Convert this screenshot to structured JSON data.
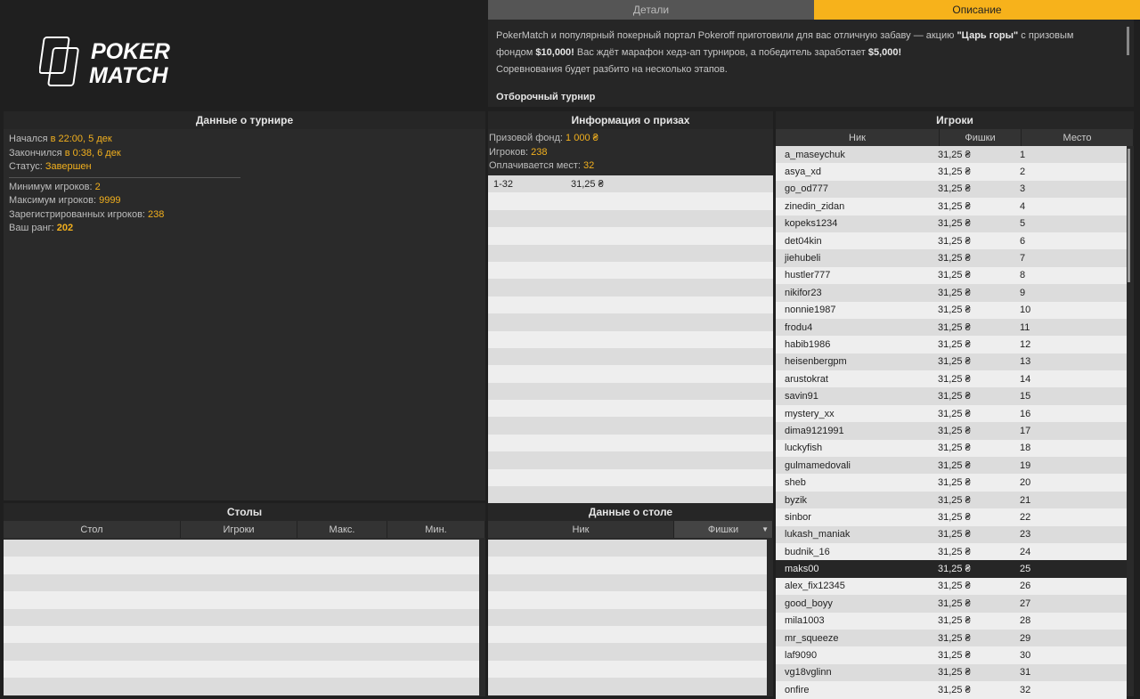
{
  "logo": {
    "line1": "POKER",
    "line2": "MATCH"
  },
  "tabs": [
    {
      "label": "Детали",
      "active": false
    },
    {
      "label": "Описание",
      "active": true
    }
  ],
  "description": {
    "p1_a": "PokerMatch и популярный покерный портал Pokeroff приготовили для вас отличную забаву — акцию ",
    "p1_b": "\"Царь горы\"",
    "p1_c": " с призовым фондом ",
    "p1_d": "$10,000!",
    "p1_e": " Вас ждёт марафон хедз-ап турниров, а победитель заработает ",
    "p1_f": "$5,000!",
    "p2": "Соревнования будет разбито на несколько этапов.",
    "heading": "Отборочный турнир"
  },
  "tournament": {
    "title": "Данные о турнире",
    "lines": [
      {
        "label": "Начался ",
        "value": "в 22:00, 5 дек"
      },
      {
        "label": "Закончился ",
        "value": "в 0:38, 6 дек"
      },
      {
        "label": "Статус: ",
        "value": "Завершен"
      }
    ],
    "lines2": [
      {
        "label": "Минимум игроков: ",
        "value": "2"
      },
      {
        "label": "Максимум игроков: ",
        "value": "9999"
      },
      {
        "label": "Зарегистрированных игроков: ",
        "value": "238"
      },
      {
        "label": "Ваш ранг: ",
        "value": "202"
      }
    ]
  },
  "prizes": {
    "title": "Информация о призах",
    "lines": [
      {
        "label": "Призовой фонд: ",
        "value": "1 000 ₴"
      },
      {
        "label": "Игроков: ",
        "value": "238"
      },
      {
        "label": "Оплачивается мест: ",
        "value": "32"
      }
    ],
    "rows": [
      {
        "places": "1-32",
        "amount": "31,25 ₴"
      }
    ]
  },
  "players": {
    "title": "Игроки",
    "columns": [
      "Ник",
      "Фишки",
      "Место"
    ],
    "selected_index": 24,
    "rows": [
      [
        "a_maseychuk",
        "31,25 ₴",
        "1"
      ],
      [
        "asya_xd",
        "31,25 ₴",
        "2"
      ],
      [
        "go_od777",
        "31,25 ₴",
        "3"
      ],
      [
        "zinedin_zidan",
        "31,25 ₴",
        "4"
      ],
      [
        "kopeks1234",
        "31,25 ₴",
        "5"
      ],
      [
        "det04kin",
        "31,25 ₴",
        "6"
      ],
      [
        "jiehubeli",
        "31,25 ₴",
        "7"
      ],
      [
        "hustler777",
        "31,25 ₴",
        "8"
      ],
      [
        "nikifor23",
        "31,25 ₴",
        "9"
      ],
      [
        "nonnie1987",
        "31,25 ₴",
        "10"
      ],
      [
        "frodu4",
        "31,25 ₴",
        "11"
      ],
      [
        "habib1986",
        "31,25 ₴",
        "12"
      ],
      [
        "heisenbergpm",
        "31,25 ₴",
        "13"
      ],
      [
        "arustokrat",
        "31,25 ₴",
        "14"
      ],
      [
        "savin91",
        "31,25 ₴",
        "15"
      ],
      [
        "mystery_xx",
        "31,25 ₴",
        "16"
      ],
      [
        "dima9121991",
        "31,25 ₴",
        "17"
      ],
      [
        "luckyfish",
        "31,25 ₴",
        "18"
      ],
      [
        "gulmamedovali",
        "31,25 ₴",
        "19"
      ],
      [
        "sheb",
        "31,25 ₴",
        "20"
      ],
      [
        "byzik",
        "31,25 ₴",
        "21"
      ],
      [
        "sinbor",
        "31,25 ₴",
        "22"
      ],
      [
        "lukash_maniak",
        "31,25 ₴",
        "23"
      ],
      [
        "budnik_16",
        "31,25 ₴",
        "24"
      ],
      [
        "maks00",
        "31,25 ₴",
        "25"
      ],
      [
        "alex_fix12345",
        "31,25 ₴",
        "26"
      ],
      [
        "good_boyy",
        "31,25 ₴",
        "27"
      ],
      [
        "mila1003",
        "31,25 ₴",
        "28"
      ],
      [
        "mr_squeeze",
        "31,25 ₴",
        "29"
      ],
      [
        "laf9090",
        "31,25 ₴",
        "30"
      ],
      [
        "vg18vglinn",
        "31,25 ₴",
        "31"
      ],
      [
        "onfire",
        "31,25 ₴",
        "32"
      ]
    ]
  },
  "tables": {
    "title": "Столы",
    "columns": [
      "Стол",
      "Игроки",
      "Макс.",
      "Мин."
    ]
  },
  "table_data": {
    "title": "Данные о столе",
    "columns": [
      "Ник",
      "Фишки"
    ]
  }
}
